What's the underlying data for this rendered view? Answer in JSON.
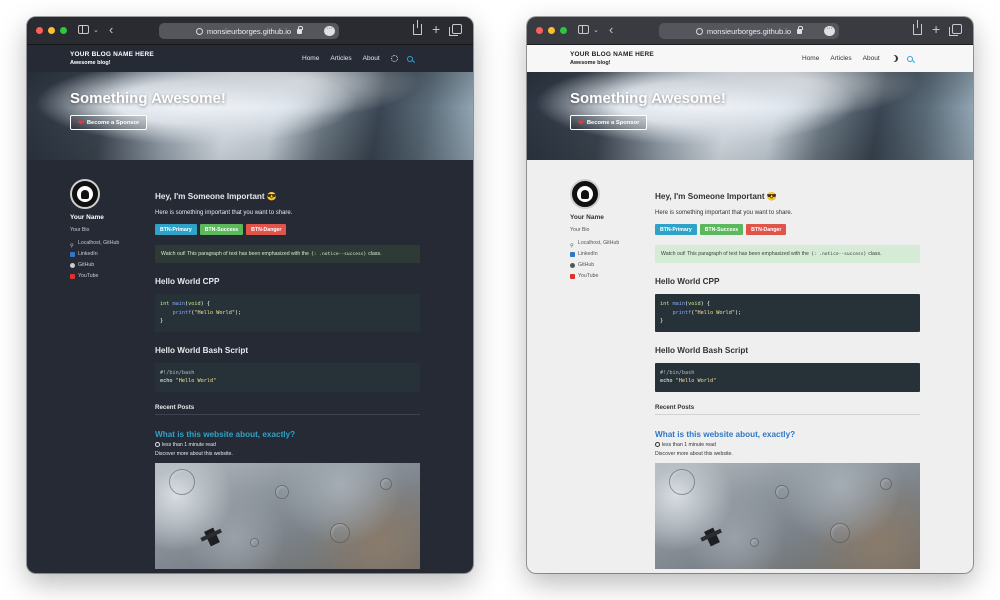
{
  "browser": {
    "url": "monsieurborges.github.io"
  },
  "site": {
    "brand_title": "YOUR BLOG NAME HERE",
    "brand_subtitle": "Awesome blog!",
    "nav": [
      "Home",
      "Articles",
      "About"
    ],
    "hero_title": "Something Awesome!",
    "sponsor_label": "Become a Sponsor"
  },
  "author": {
    "name": "Your Name",
    "bio": "Your Bio",
    "links": [
      "Localhost, GitHub",
      "LinkedIn",
      "GitHub",
      "YouTube"
    ]
  },
  "content": {
    "heading": "Hey, I'm Someone Important 😎",
    "paragraph": "Here is something important that you want to share.",
    "buttons": [
      "BTN-Primary",
      "BTN-Success",
      "BTN-Danger"
    ],
    "notice_before": "Watch out! This paragraph of text has been emphasized with the",
    "notice_code": "{: .notice--success}",
    "notice_after": "class.",
    "cpp_heading": "Hello World CPP",
    "cpp_code": {
      "line1_kw": "int",
      "line1_fn": "main",
      "line1_open": "(",
      "line1_arg": "void",
      "line1_close": ") {",
      "line2_fn": "printf",
      "line2_open": "(",
      "line2_str": "\"Hello World\"",
      "line2_close": ");",
      "line3": "}"
    },
    "bash_heading": "Hello World Bash Script",
    "bash_code": {
      "line1": "#!/bin/bash",
      "line2_cmd": "echo",
      "line2_str": "\"Hello World\""
    },
    "recent_posts_heading": "Recent Posts",
    "post": {
      "title": "What is this website about, exactly?",
      "read_time": "less than 1 minute read",
      "excerpt": "Discover more about this website."
    }
  },
  "theme": {
    "dark_bg": "#252a34",
    "light_bg": "#efefef",
    "accent_teal": "#2ea3c7",
    "success_green": "#5cb85c",
    "danger_red": "#e0544a",
    "code_bg": "#263238"
  },
  "icons": {
    "location": "map-pin-icon",
    "linkedin": "linkedin-icon",
    "github": "github-icon",
    "youtube": "youtube-icon"
  }
}
